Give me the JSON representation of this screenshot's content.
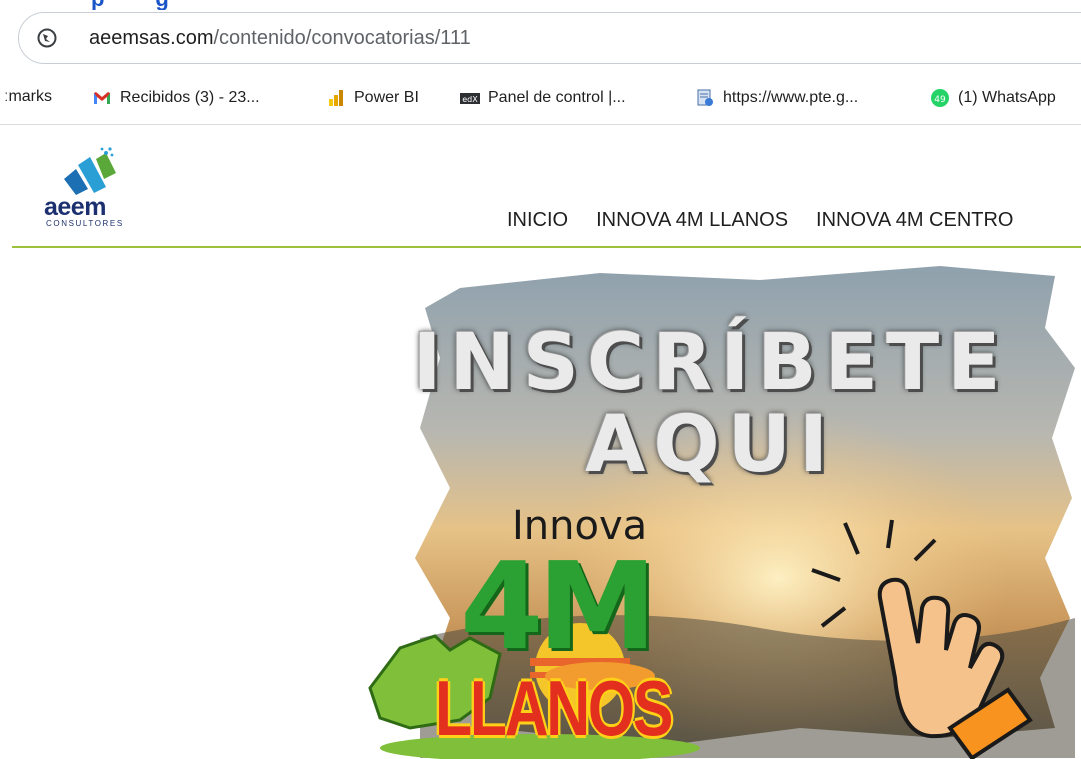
{
  "browser": {
    "address_bar": {
      "host": "aeemsas.com",
      "path": "/contenido/convocatorias/111"
    },
    "bookmarks": [
      {
        "label": "ːmarks",
        "icon": "bookmarks-folder-icon"
      },
      {
        "label": "Recibidos (3) - 23...",
        "icon": "gmail-icon"
      },
      {
        "label": "Power BI",
        "icon": "power-bi-icon"
      },
      {
        "label": "Panel de control |...",
        "icon": "edx-icon"
      },
      {
        "label": "https://www.pte.g...",
        "icon": "document-money-icon"
      },
      {
        "label": "(1) WhatsApp",
        "icon": "whatsapp-icon",
        "badge": "49"
      }
    ]
  },
  "site": {
    "logo": {
      "name": "aeem",
      "subtitle": "CONSULTORES"
    },
    "nav": [
      "INICIO",
      "INNOVA 4M LLANOS",
      "INNOVA 4M CENTRO"
    ]
  },
  "banner": {
    "headline_line1": "INSCRÍBETE",
    "headline_line2": "AQUI",
    "brand_top": "Innova",
    "brand_mid": "4M",
    "brand_bottom": "LLANOS",
    "icon": "click-hand-icon"
  },
  "colors": {
    "nav_rule": "#9cc23a",
    "brand_green": "#2aa132",
    "brand_red": "#e3301e",
    "brand_yellow": "#ffd018"
  }
}
